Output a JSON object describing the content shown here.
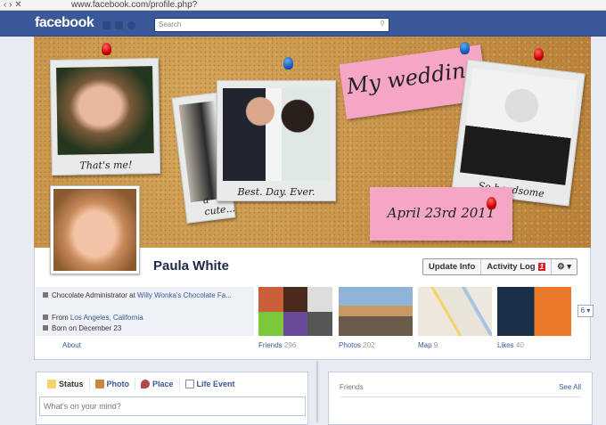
{
  "browser": {
    "url": "www.facebook.com/profile.php?"
  },
  "header": {
    "logo": "facebook",
    "search_placeholder": "Search"
  },
  "cover": {
    "captions": [
      "That's me!",
      "Best. Day. Ever.",
      "a cute...",
      "So handsome"
    ],
    "notes": [
      "My wedding",
      "April 23rd 2011"
    ]
  },
  "profile": {
    "name": "Paula White"
  },
  "actions": {
    "update_info": "Update Info",
    "activity_log": "Activity Log",
    "activity_count": "1",
    "settings": "⚙ ▾"
  },
  "info": {
    "work_prefix": "Chocolate Administrator at ",
    "work_link": "Willy Wonka's Chocolate Fa...",
    "from_prefix": "From ",
    "from_link": "Los Angeles, California",
    "born": "Born on December 23"
  },
  "about": "About",
  "sections": [
    {
      "label": "Friends",
      "count": "296"
    },
    {
      "label": "Photos",
      "count": "202"
    },
    {
      "label": "Map",
      "count": "9"
    },
    {
      "label": "Likes",
      "count": "40"
    }
  ],
  "more_button": "6 ▾",
  "composer": {
    "tabs": [
      "Status",
      "Photo",
      "Place",
      "Life Event"
    ],
    "placeholder": "What's on your mind?"
  },
  "friends_box": {
    "title": "Friends",
    "see_all": "See All"
  }
}
